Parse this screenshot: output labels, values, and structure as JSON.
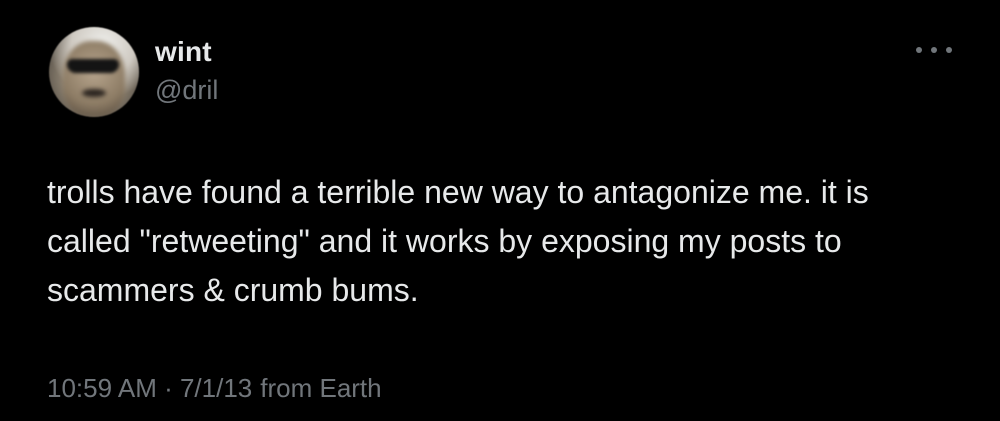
{
  "tweet": {
    "author": {
      "name": "wint",
      "handle": "@dril"
    },
    "text": "trolls have found a terrible new way to antagonize me. it is\ncalled \"retweeting\" and it works by exposing my posts to\nscammers & crumb bums.",
    "timestamp": "10:59 AM · 7/1/13",
    "source": "from Earth"
  },
  "icons": {
    "more": "more-horizontal-icon",
    "avatar": "avatar-image"
  },
  "colors": {
    "background": "#000000",
    "primary_text": "#e7e9ea",
    "secondary_text": "#71767b"
  }
}
